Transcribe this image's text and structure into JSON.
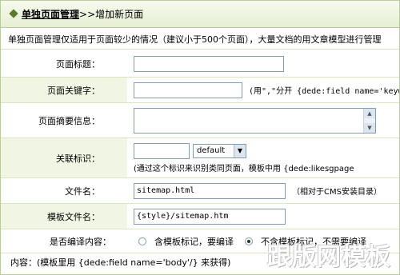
{
  "header": {
    "link_label": "单独页面管理",
    "separator": ">>",
    "page_title": "增加新页面"
  },
  "description": "单独页面管理仅适用于页面较少的情况（建议小于500个页面），大量文档的用文章模型进行管理",
  "form": {
    "title": {
      "label": "页面标题：",
      "value": ""
    },
    "keywords": {
      "label": "页面关键字：",
      "value": "",
      "hint": "(用\",\"分开 {dede:field name='keywords'/}"
    },
    "summary": {
      "label": "页面摘要信息：",
      "value": ""
    },
    "likeid": {
      "label": "关联标识：",
      "value": "",
      "select_value": "default",
      "hint": "(通过这个标识来识别类同页面，模板中用 {dede:likesgpage"
    },
    "filename": {
      "label": "文件名：",
      "value": "sitemap.html",
      "hint": "（相对于CMS安装目录）"
    },
    "template": {
      "label": "模板文件名：",
      "value": "{style}/sitemap.htm"
    },
    "compile": {
      "label": "是否编译内容：",
      "option1": "含模板标记，要编译",
      "option2": "不含模板标记，不需要编译",
      "selected": "option2"
    }
  },
  "footer": {
    "content_label": "内容：(模板里用 {dede:field name='body'/} 来获得)"
  },
  "watermark": "跟版网模板"
}
